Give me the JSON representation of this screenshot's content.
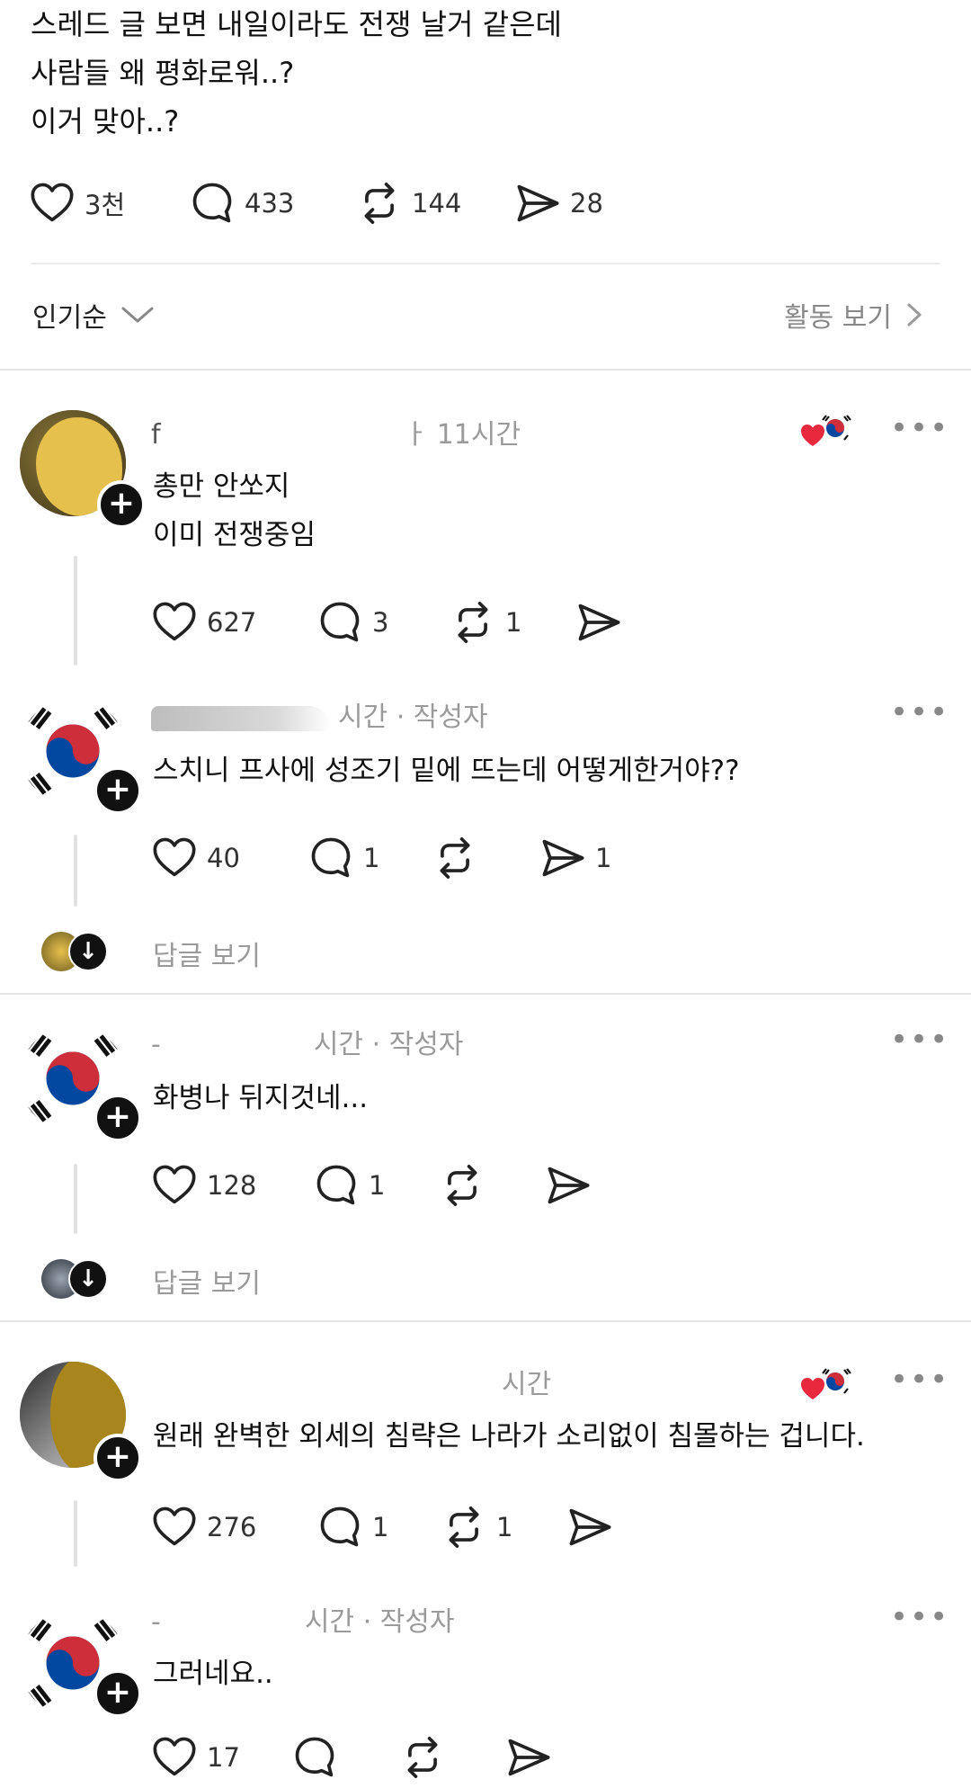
{
  "post": {
    "lines": [
      "스레드 글 보면 내일이라도 전쟁 날거 같은데",
      "사람들 왜 평화로워..?",
      "이거 맞아..?"
    ],
    "stats": {
      "likes": "3천",
      "replies": "433",
      "reposts": "144",
      "shares": "28"
    }
  },
  "controls": {
    "sort_label": "인기순",
    "activity_label": "활동 보기"
  },
  "comments": [
    {
      "meta": "ㅏ 11시간",
      "lines": [
        "총만 안쏘지",
        "이미 전쟁중임"
      ],
      "likes": "627",
      "replies": "3",
      "reposts": "1",
      "shares": ""
    },
    {
      "meta": "시간 · 작성자",
      "lines": [
        "스치니 프사에 성조기 밑에 뜨는데 어떻게한거야??"
      ],
      "likes": "40",
      "replies": "1",
      "reposts": "",
      "shares": "1",
      "view_replies": "답글 보기"
    },
    {
      "meta": "시간 · 작성자",
      "lines": [
        "화병나 뒤지것네..."
      ],
      "likes": "128",
      "replies": "1",
      "reposts": "",
      "shares": "",
      "view_replies": "답글 보기"
    },
    {
      "meta": "시간",
      "lines": [
        "원래 완벽한 외세의 침략은 나라가 소리없이 침몰하는 겁니다."
      ],
      "likes": "276",
      "replies": "1",
      "reposts": "1",
      "shares": ""
    },
    {
      "meta": "시간 · 작성자",
      "lines": [
        "그러네요.."
      ],
      "likes": "17",
      "replies": "",
      "reposts": "",
      "shares": ""
    }
  ],
  "icons": {
    "like": "heart-icon",
    "reply": "speech-bubble-icon",
    "repost": "repost-icon",
    "share": "send-icon",
    "more": "more-icon"
  },
  "colors": {
    "flag_red": "#cd2e3a",
    "flag_blue": "#0047a0",
    "heart_red": "#e8293d"
  }
}
